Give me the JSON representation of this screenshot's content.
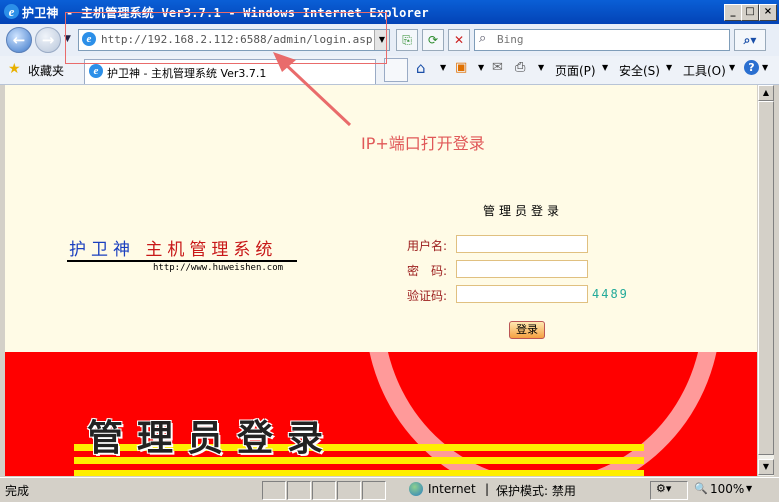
{
  "window": {
    "title": "护卫神 - 主机管理系统 Ver3.7.1 - Windows Internet Explorer",
    "minimize_glyph": "_",
    "maximize_glyph": "□",
    "close_glyph": "×"
  },
  "address_bar": {
    "url": "http://192.168.2.112:6588/admin/login.asp",
    "search_placeholder": "Bing"
  },
  "favorites": {
    "label": "收藏夹",
    "tab_title": "护卫神 - 主机管理系统 Ver3.7.1"
  },
  "toolbar": {
    "page_label": "页面(P)",
    "safety_label": "安全(S)",
    "tools_label": "工具(O)",
    "help_glyph": "?"
  },
  "annotation": {
    "text": "IP+端口打开登录"
  },
  "page": {
    "logo_part1": "护卫神",
    "logo_part2": "主机管理系统",
    "logo_url": "http://www.huweishen.com",
    "login_title": "管理员登录",
    "username_label": "用户名:",
    "password_label": "密　码:",
    "captcha_label": "验证码:",
    "captcha_code": "4489",
    "login_button": "登录",
    "banner_text": "管理员登录"
  },
  "status_bar": {
    "status": "完成",
    "zone": "Internet",
    "protected_mode": "保护模式: 禁用",
    "zoom": "100%"
  },
  "colors": {
    "banner_red": "#ff0000",
    "content_bg": "#fffbe6",
    "annotation": "#e05858"
  }
}
